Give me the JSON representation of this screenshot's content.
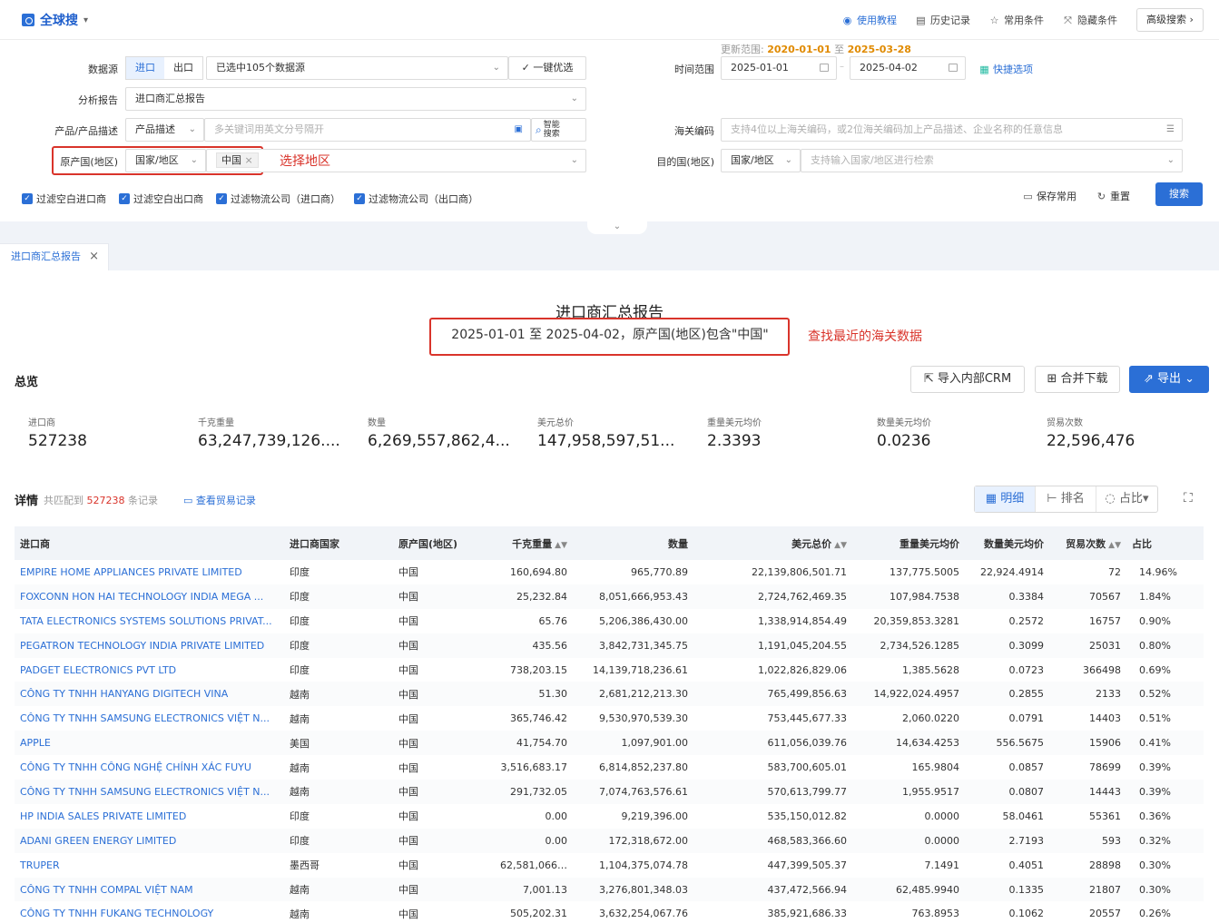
{
  "app": {
    "title": "全球搜"
  },
  "top_links": {
    "tutorial": "使用教程",
    "history": "历史记录",
    "common": "常用条件",
    "hidden": "隐藏条件",
    "advanced": "高级搜索 ›"
  },
  "form": {
    "datasource_label": "数据源",
    "import": "进口",
    "export": "出口",
    "datasource_value": "已选中105个数据源",
    "optimize": "一键优选",
    "update_range_label": "更新范围:",
    "update_from": "2020-01-01",
    "update_sep": "至",
    "update_to": "2025-03-28",
    "time_range_label": "时间范围",
    "date_from": "2025-01-01",
    "date_to": "2025-04-02",
    "quick_options": "快捷选项",
    "report_label": "分析报告",
    "report_value": "进口商汇总报告",
    "product_label": "产品/产品描述",
    "product_type": "产品描述",
    "product_placeholder": "多关键词用英文分号隔开",
    "smart_search": "智能搜索",
    "hs_label": "海关编码",
    "hs_placeholder": "支持4位以上海关编码，或2位海关编码加上产品描述、企业名称的任意信息",
    "origin_label": "原产国(地区)",
    "origin_type": "国家/地区",
    "origin_tag": "中国",
    "origin_annotation": "选择地区",
    "dest_label": "目的国(地区)",
    "dest_type": "国家/地区",
    "dest_placeholder": "支持输入国家/地区进行检索",
    "filters": [
      "过滤空白进口商",
      "过滤空白出口商",
      "过滤物流公司（进口商）",
      "过滤物流公司（出口商）"
    ],
    "save": "保存常用",
    "reset": "重置",
    "search": "搜索"
  },
  "tab": {
    "label": "进口商汇总报告"
  },
  "report": {
    "title": "进口商汇总报告",
    "subtitle": "2025-01-01 至 2025-04-02，原产国(地区)包含\"中国\"",
    "annotation": "查找最近的海关数据"
  },
  "overview": {
    "title": "总览",
    "buttons": {
      "crm": "导入内部CRM",
      "merge": "合并下载",
      "export": "导出"
    },
    "stats": [
      {
        "label": "进口商",
        "value": "527238"
      },
      {
        "label": "千克重量",
        "value": "63,247,739,126...."
      },
      {
        "label": "数量",
        "value": "6,269,557,862,4..."
      },
      {
        "label": "美元总价",
        "value": "147,958,597,51..."
      },
      {
        "label": "重量美元均价",
        "value": "2.3393"
      },
      {
        "label": "数量美元均价",
        "value": "0.0236"
      },
      {
        "label": "贸易次数",
        "value": "22,596,476"
      }
    ]
  },
  "detail": {
    "title": "详情",
    "count_prefix": "共匹配到",
    "count": "527238",
    "count_suffix": "条记录",
    "view_trade": "查看贸易记录",
    "views": [
      "明细",
      "排名",
      "占比"
    ]
  },
  "table": {
    "columns": [
      "进口商",
      "进口商国家",
      "原产国(地区)",
      "千克重量",
      "数量",
      "美元总价",
      "重量美元均价",
      "数量美元均价",
      "贸易次数",
      "占比"
    ],
    "rows": [
      [
        "EMPIRE HOME APPLIANCES PRIVATE LIMITED",
        "印度",
        "中国",
        "160,694.80",
        "965,770.89",
        "22,139,806,501.71",
        "137,775.5005",
        "22,924.4914",
        "72",
        "14.96%"
      ],
      [
        "FOXCONN HON HAI TECHNOLOGY INDIA MEGA ...",
        "印度",
        "中国",
        "25,232.84",
        "8,051,666,953.43",
        "2,724,762,469.35",
        "107,984.7538",
        "0.3384",
        "70567",
        "1.84%"
      ],
      [
        "TATA ELECTRONICS SYSTEMS SOLUTIONS PRIVAT...",
        "印度",
        "中国",
        "65.76",
        "5,206,386,430.00",
        "1,338,914,854.49",
        "20,359,853.3281",
        "0.2572",
        "16757",
        "0.90%"
      ],
      [
        "PEGATRON TECHNOLOGY INDIA PRIVATE LIMITED",
        "印度",
        "中国",
        "435.56",
        "3,842,731,345.75",
        "1,191,045,204.55",
        "2,734,526.1285",
        "0.3099",
        "25031",
        "0.80%"
      ],
      [
        "PADGET ELECTRONICS PVT LTD",
        "印度",
        "中国",
        "738,203.15",
        "14,139,718,236.61",
        "1,022,826,829.06",
        "1,385.5628",
        "0.0723",
        "366498",
        "0.69%"
      ],
      [
        "CÔNG TY TNHH HANYANG DIGITECH VINA",
        "越南",
        "中国",
        "51.30",
        "2,681,212,213.30",
        "765,499,856.63",
        "14,922,024.4957",
        "0.2855",
        "2133",
        "0.52%"
      ],
      [
        "CÔNG TY TNHH SAMSUNG ELECTRONICS VIỆT N...",
        "越南",
        "中国",
        "365,746.42",
        "9,530,970,539.30",
        "753,445,677.33",
        "2,060.0220",
        "0.0791",
        "14403",
        "0.51%"
      ],
      [
        "APPLE",
        "美国",
        "中国",
        "41,754.70",
        "1,097,901.00",
        "611,056,039.76",
        "14,634.4253",
        "556.5675",
        "15906",
        "0.41%"
      ],
      [
        "CÔNG TY TNHH CÔNG NGHỆ CHÍNH XÁC FUYU",
        "越南",
        "中国",
        "3,516,683.17",
        "6,814,852,237.80",
        "583,700,605.01",
        "165.9804",
        "0.0857",
        "78699",
        "0.39%"
      ],
      [
        "CÔNG TY TNHH SAMSUNG ELECTRONICS VIỆT N...",
        "越南",
        "中国",
        "291,732.05",
        "7,074,763,576.61",
        "570,613,799.77",
        "1,955.9517",
        "0.0807",
        "14443",
        "0.39%"
      ],
      [
        "HP INDIA SALES PRIVATE LIMITED",
        "印度",
        "中国",
        "0.00",
        "9,219,396.00",
        "535,150,012.82",
        "0.0000",
        "58.0461",
        "55361",
        "0.36%"
      ],
      [
        "ADANI GREEN ENERGY LIMITED",
        "印度",
        "中国",
        "0.00",
        "172,318,672.00",
        "468,583,366.60",
        "0.0000",
        "2.7193",
        "593",
        "0.32%"
      ],
      [
        "TRUPER",
        "墨西哥",
        "中国",
        "62,581,066....",
        "1,104,375,074.78",
        "447,399,505.37",
        "7.1491",
        "0.4051",
        "28898",
        "0.30%"
      ],
      [
        "CÔNG TY TNHH COMPAL VIỆT NAM",
        "越南",
        "中国",
        "7,001.13",
        "3,276,801,348.03",
        "437,472,566.94",
        "62,485.9940",
        "0.1335",
        "21807",
        "0.30%"
      ],
      [
        "CÔNG TY TNHH FUKANG TECHNOLOGY",
        "越南",
        "中国",
        "505,202.31",
        "3,632,254,067.76",
        "385,921,686.33",
        "763.8953",
        "0.1062",
        "20557",
        "0.26%"
      ]
    ]
  }
}
